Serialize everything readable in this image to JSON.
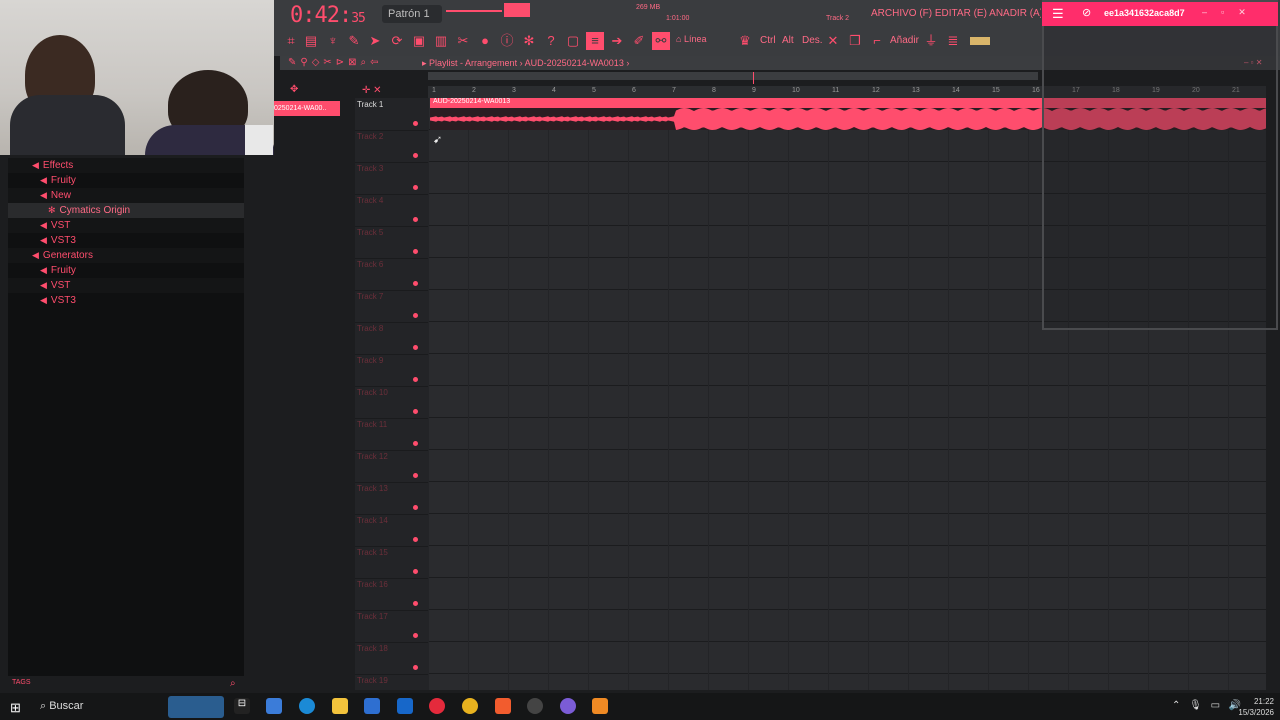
{
  "webcam": {
    "label": "webcam overlay"
  },
  "toolbar": {
    "time_main": "0:42",
    "time_sub": "35",
    "pattern": "Patrón 1",
    "memory": "269 MB",
    "cpu_counter": "1",
    "time_small": "1:01:00",
    "track_hint": "Track 2",
    "menu_text": "ARCHIVO (F) EDITAR (E) AÑADIR (A) PATRONES (P)",
    "line_mode": "Línea",
    "ctrl": "Ctrl",
    "alt": "Alt",
    "des": "Des.",
    "anadir": "Añadir",
    "accent": "#ff4d6d"
  },
  "playlist": {
    "breadcrumb_root": "Playlist - Arrangement",
    "breadcrumb_item": "AUD-20250214-WA0013",
    "picker_clip": "0250214-WA00..",
    "clip_name": "AUD-20250214-WA0013",
    "ruler": [
      "1",
      "2",
      "3",
      "4",
      "5",
      "6",
      "7",
      "8",
      "9",
      "10",
      "11",
      "12",
      "13",
      "14",
      "15",
      "16",
      "17",
      "18",
      "19",
      "20",
      "21"
    ],
    "tracks": [
      "Track 1",
      "Track 2",
      "Track 3",
      "Track 4",
      "Track 5",
      "Track 6",
      "Track 7",
      "Track 8",
      "Track 9",
      "Track 10",
      "Track 11",
      "Track 12",
      "Track 13",
      "Track 14",
      "Track 15",
      "Track 16",
      "Track 17",
      "Track 18",
      "Track 19"
    ]
  },
  "browser": {
    "items": [
      {
        "label": "Effects",
        "level": 0
      },
      {
        "label": "Fruity",
        "level": 1
      },
      {
        "label": "New",
        "level": 1
      },
      {
        "label": "Cymatics Origin",
        "level": 2
      },
      {
        "label": "VST",
        "level": 1
      },
      {
        "label": "VST3",
        "level": 1
      },
      {
        "label": "Generators",
        "level": 0
      },
      {
        "label": "Fruity",
        "level": 1
      },
      {
        "label": "VST",
        "level": 1
      },
      {
        "label": "VST3",
        "level": 1
      }
    ],
    "tags": "TAGS"
  },
  "overlay_window": {
    "title": "ee1a341632aca8d7"
  },
  "taskbar": {
    "search": "Buscar",
    "time": "21:22",
    "date": "15/3/2026"
  }
}
